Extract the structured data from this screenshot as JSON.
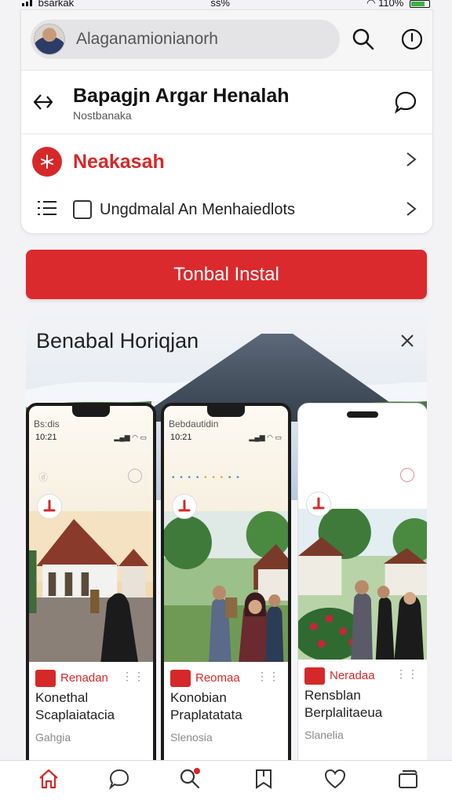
{
  "status_bar": {
    "carrier": "bsarkak",
    "time": "ss%",
    "battery": "110%"
  },
  "search": {
    "value": "Alaganamionianorh"
  },
  "header": {
    "title": "Bapagjn Argar Henalah",
    "subtitle": "Nostbanaka"
  },
  "menu": {
    "brand_label": "Neakasah",
    "checkbox_label": "Ungdmalal An Menhaiedlots",
    "checkbox_checked": false
  },
  "install_button": {
    "label": "Tonbal Instal"
  },
  "gallery": {
    "title": "Benabal Horiqjan",
    "previews": [
      {
        "brand": "Bs:dis",
        "time": "10:21",
        "tag": "Renadan",
        "line1": "Konethal",
        "line2": "Scaplaiatacia",
        "line3": "Gahgia"
      },
      {
        "brand": "Bebdautidin",
        "time": "10:21",
        "tag": "Reomaa",
        "line1": "Konobian",
        "line2": "Praplatatata",
        "line3": "Slenosia"
      },
      {
        "brand": "",
        "time": "",
        "tag": "Neradaa",
        "line1": "Rensblan",
        "line2": "Berplalitaeua",
        "line3": "Slanelia"
      }
    ]
  },
  "bottom_nav": [
    {
      "icon": "home-icon"
    },
    {
      "icon": "chat-icon"
    },
    {
      "icon": "search-icon"
    },
    {
      "icon": "bookmark-icon"
    },
    {
      "icon": "heart-icon"
    },
    {
      "icon": "tabs-icon"
    }
  ],
  "colors": {
    "accent": "#d62828",
    "button": "#db2a2e",
    "progress": "#4ca64c"
  }
}
